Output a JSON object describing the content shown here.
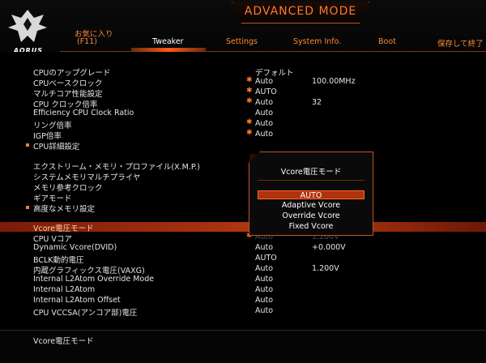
{
  "header": {
    "mode_title": "ADVANCED MODE",
    "logo_text": "AORUS",
    "tabs": [
      {
        "label_top": "お気に入り",
        "label": "(F11)"
      },
      {
        "label": "Tweaker"
      },
      {
        "label": "Settings"
      },
      {
        "label": "System Info."
      },
      {
        "label": "Boot"
      },
      {
        "label": "保存して終了"
      }
    ]
  },
  "settings": [
    {
      "label": "CPUのアップグレード",
      "value": "デフォルト",
      "value2": ""
    },
    {
      "label": "CPUベースクロック",
      "value": "Auto",
      "value2": "100.00MHz"
    },
    {
      "label": "マルチコア性能設定",
      "value": "AUTO",
      "value2": ""
    },
    {
      "label": "CPU クロック倍率",
      "value": "Auto",
      "value2": "32"
    },
    {
      "label": "Efficiency CPU Clock Ratio",
      "value": "Auto",
      "value2": ""
    },
    {
      "label": "リング倍率",
      "value": "Auto",
      "value2": ""
    },
    {
      "label": "IGP倍率",
      "value": "Auto",
      "value2": ""
    },
    {
      "label": "CPU詳細設定",
      "value": "",
      "value2": ""
    },
    {
      "label": "エクストリーム・メモリ・プロファイル(X.M.P.)",
      "value": "",
      "value2": ""
    },
    {
      "label": "システムメモリマルチプライヤ",
      "value": "",
      "value2": ""
    },
    {
      "label": "メモリ参考クロック",
      "value": "",
      "value2": ""
    },
    {
      "label": "ギアモード",
      "value": "",
      "value2": ""
    },
    {
      "label": "高度なメモリ設定",
      "value": "",
      "value2": ""
    },
    {
      "label": "Vcore電圧モード",
      "value": "",
      "value2": ""
    },
    {
      "label": "CPU Vコア",
      "value": "Auto",
      "value2": "1.200V"
    },
    {
      "label": "Dynamic Vcore(DVID)",
      "value": "Auto",
      "value2": "+0.000V"
    },
    {
      "label": "BCLK動的電圧",
      "value": "AUTO",
      "value2": ""
    },
    {
      "label": "内蔵グラフィックス電圧(VAXG)",
      "value": "Auto",
      "value2": "1.200V"
    },
    {
      "label": "Internal L2Atom Override Mode",
      "value": "Auto",
      "value2": ""
    },
    {
      "label": "Internal L2Atom",
      "value": "Auto",
      "value2": ""
    },
    {
      "label": "Internal L2Atom Offset",
      "value": "Auto",
      "value2": ""
    },
    {
      "label": "CPU VCCSA(アンコア部)電圧",
      "value": "Auto",
      "value2": ""
    }
  ],
  "popup": {
    "title": "Vcore電圧モード",
    "options": [
      "AUTO",
      "Adaptive Vcore",
      "Override Vcore",
      "Fixed Vcore"
    ]
  },
  "status": {
    "text": "Vcore電圧モード"
  },
  "colors": {
    "accent": "#ff7a2b",
    "selected_bar": "#b83a10",
    "background": "#000000"
  }
}
